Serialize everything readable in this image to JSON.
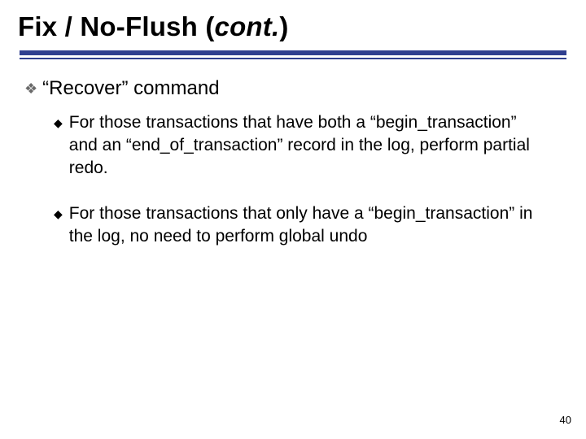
{
  "title": {
    "main": "Fix / No-Flush (",
    "cont": "cont.",
    "tail": ")"
  },
  "bullets": {
    "lvl1": {
      "text": "“Recover” command"
    },
    "lvl2a": {
      "text": "For those transactions that have both a “begin_transaction” and an “end_of_transaction” record in the log, perform partial redo."
    },
    "lvl2b": {
      "text": "For those transactions that only have a “begin_transaction” in the log, no need to perform global undo"
    }
  },
  "pagenum": "40",
  "glyphs": {
    "diamond": "❖",
    "dot": "◆"
  }
}
